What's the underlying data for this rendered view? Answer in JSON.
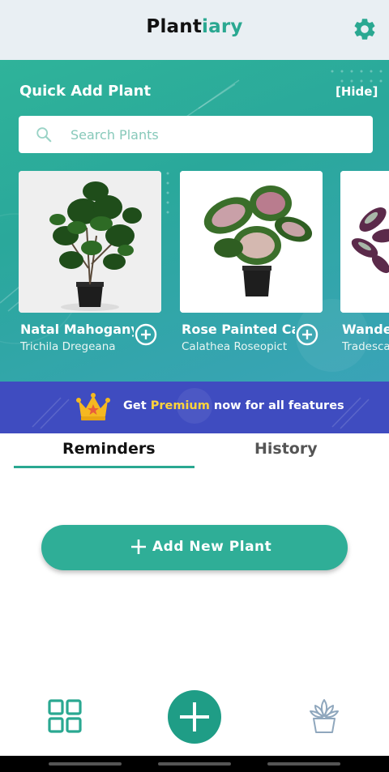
{
  "app": {
    "title_part1": "Plant",
    "title_part2": "iary"
  },
  "header": {
    "settings_icon": "gear-icon"
  },
  "quick_add": {
    "title": "Quick Add Plant",
    "hide_label": "[Hide]",
    "search": {
      "placeholder": "Search Plants",
      "value": ""
    },
    "plants": [
      {
        "name": "Natal Mahogany",
        "scientific": "Trichila Dregeana"
      },
      {
        "name": "Rose Painted Calathea",
        "scientific": "Calathea Roseopicta"
      },
      {
        "name": "Wandering Jew",
        "scientific": "Tradescantia"
      }
    ]
  },
  "premium": {
    "text_before": "Get ",
    "highlight": "Premium",
    "text_after": " now for all features"
  },
  "tabs": [
    {
      "label": "Reminders",
      "active": true
    },
    {
      "label": "History",
      "active": false
    }
  ],
  "actions": {
    "add_new_plant": "Add New Plant"
  },
  "colors": {
    "accent": "#2aa891",
    "premium_bg": "#3f4cc0",
    "premium_highlight": "#ffd43b",
    "header_bg": "#e9eff3"
  }
}
